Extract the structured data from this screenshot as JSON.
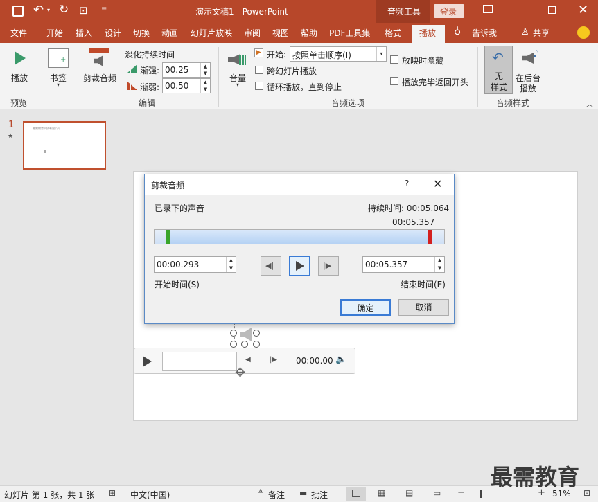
{
  "titlebar": {
    "doc_title": "演示文稿1  -  PowerPoint",
    "context_tool": "音频工具",
    "login_label": "登录"
  },
  "tabs": [
    "文件",
    "开始",
    "插入",
    "设计",
    "切换",
    "动画",
    "幻灯片放映",
    "审阅",
    "视图",
    "帮助",
    "PDF工具集",
    "格式",
    "播放"
  ],
  "tell_me": "告诉我",
  "share": "共享",
  "ribbon": {
    "play_label": "播放",
    "preview_group": "预览",
    "bookmark_label": "书签",
    "trim_label": "剪裁音频",
    "fade_title": "淡化持续时间",
    "fade_in_label": "渐强:",
    "fade_in_value": "00.25",
    "fade_out_label": "渐弱:",
    "fade_out_value": "00.50",
    "edit_group": "编辑",
    "volume_label": "音量",
    "start_label": "开始:",
    "start_value": "按照单击顺序(I)",
    "play_across_label": "跨幻灯片播放",
    "loop_label": "循环播放，直到停止",
    "hide_label": "放映时隐藏",
    "rewind_label": "播放完毕返回开头",
    "audio_options_group": "音频选项",
    "no_style_line1": "无",
    "no_style_line2": "样式",
    "bg_play_line1": "在后台",
    "bg_play_line2": "播放",
    "audio_styles_group": "音频样式"
  },
  "thumbnail": {
    "number": "1",
    "star": "★",
    "text": "最需教育科技有限公司"
  },
  "dialog": {
    "title": "剪裁音频",
    "help": "?",
    "recorded_label": "已录下的声音",
    "duration_label": "持续时间: 00:05.064",
    "marker_time": "00:05.357",
    "start_time_value": "00:00.293",
    "end_time_value": "00:05.357",
    "start_time_label": "开始时间(S)",
    "end_time_label": "结束时间(E)",
    "ok": "确定",
    "cancel": "取消",
    "progress": {
      "start_fraction": 0.04,
      "end_fraction": 0.96
    }
  },
  "player": {
    "time": "00:00.00"
  },
  "status": {
    "slide_info": "幻灯片 第 1 张，共 1 张",
    "language": "中文(中国)",
    "notes": "备注",
    "comments": "批注",
    "zoom": "51%"
  },
  "watermark": "最需教育",
  "colors": {
    "accent": "#b7472a",
    "dialog_border": "#5a8ac6",
    "start_marker": "#3aa52b",
    "end_marker": "#d32020"
  }
}
